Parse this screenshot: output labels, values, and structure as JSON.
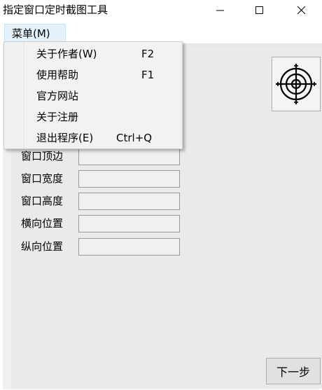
{
  "window": {
    "title": "指定窗口定时截图工具"
  },
  "menubar": {
    "root_label": "菜单(M)"
  },
  "menu": {
    "items": [
      {
        "label": "关于作者(W)",
        "shortcut": "F2"
      },
      {
        "label": "使用帮助",
        "shortcut": "F1"
      },
      {
        "label": "官方网站",
        "shortcut": ""
      },
      {
        "label": "关于注册",
        "shortcut": ""
      },
      {
        "label": "退出程序(E)",
        "shortcut": "Ctrl+Q"
      }
    ]
  },
  "form": {
    "fields": [
      {
        "label": "窗口顶边",
        "value": ""
      },
      {
        "label": "窗口宽度",
        "value": ""
      },
      {
        "label": "窗口高度",
        "value": ""
      },
      {
        "label": "横向位置",
        "value": ""
      },
      {
        "label": "纵向位置",
        "value": ""
      }
    ]
  },
  "buttons": {
    "next": "下一步"
  },
  "icons": {
    "finder": "crosshair-target-icon"
  }
}
